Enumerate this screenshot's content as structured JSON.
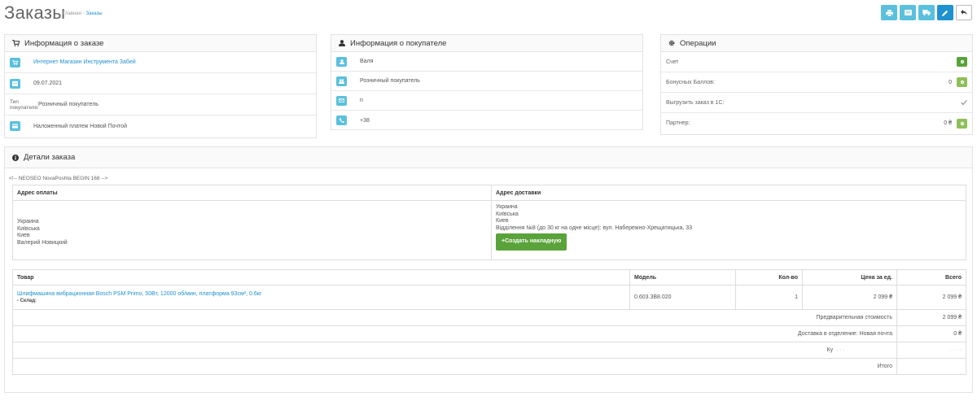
{
  "header": {
    "title": "Заказы",
    "breadcrumb": [
      "Главная",
      "Заказы"
    ],
    "actions": [
      {
        "name": "print-invoice-button",
        "icon": "print-icon"
      },
      {
        "name": "print-shipping-button",
        "icon": "list-icon"
      },
      {
        "name": "delivery-button",
        "icon": "truck-icon"
      },
      {
        "name": "edit-button",
        "icon": "pencil-icon"
      },
      {
        "name": "back-button",
        "icon": "reply-icon"
      }
    ]
  },
  "order_info": {
    "title": "Информация о заказе",
    "store": "Интернет Магазин Инструмента Забей",
    "date": "09.07.2021",
    "customer_type_label": "Тип покупателя:",
    "customer_type": "Розничный покупатель",
    "payment_method": "Наложенный платеж Новой Почтой"
  },
  "customer_info": {
    "title": "Информация о покупателе",
    "name": "Валя",
    "group": "Розничный покупатель",
    "email": "n",
    "phone": "+38"
  },
  "operations": {
    "title": "Операции",
    "invoice_label": "Счет",
    "bonus_label": "Бонусных Баллов:",
    "bonus_value": "0",
    "export_label": "Выгрузить заказ в 1С:",
    "partner_label": "Партнер:",
    "partner_value": "0 ₴"
  },
  "details": {
    "title": "Детали заказа",
    "comment": "<!-- NEOSEO NovaPoshta BEGIN 168 -->",
    "payment_address_header": "Адрес оплаты",
    "shipping_address_header": "Адрес доставки",
    "payment_address": [
      "Украина",
      "Київська",
      "Киев",
      "Валерий Новицкий"
    ],
    "shipping_address": [
      "Украина",
      "Київська",
      "Киев",
      "Відділення №8 (до 30 кг на одне місце): вул. Набережно-Хрещатицька, 33"
    ],
    "create_waybill_label": "+Создать накладную"
  },
  "products": {
    "headers": [
      "Товар",
      "Модель",
      "Кол-во",
      "Цена за ед.",
      "Всего"
    ],
    "rows": [
      {
        "name": "Шлифмашина вибрационная Bosch PSM Primo, 50Вт, 12000 об/мин, платформа 93см², 0.6кг",
        "option": "- Склад:",
        "model": "0.603.3B8.020",
        "qty": "1",
        "price": "2 099 ₴",
        "total": "2 099 ₴"
      }
    ],
    "totals": [
      {
        "label": "Предварительная стоимость",
        "value": "2 099 ₴"
      },
      {
        "label": "Доставка в отделение: Новая почта",
        "value": "0 ₴"
      },
      {
        "label": "Ку",
        "value": ""
      },
      {
        "label": "Итого",
        "value": ""
      }
    ]
  },
  "colors": {
    "info": "#5bc0de",
    "primary": "#1e91cf",
    "success": "#5aa23a",
    "success_light": "#8fbf5a"
  }
}
